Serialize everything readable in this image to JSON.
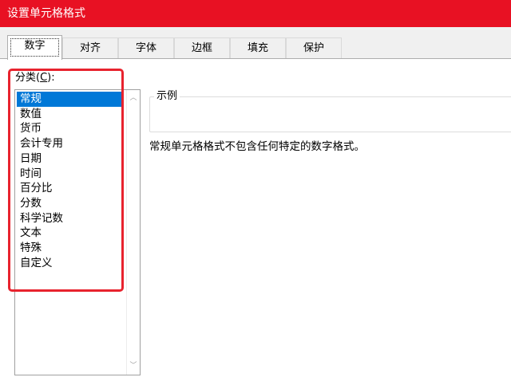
{
  "window": {
    "title": "设置单元格格式"
  },
  "tabs": [
    {
      "label": "数字",
      "active": true
    },
    {
      "label": "对齐"
    },
    {
      "label": "字体"
    },
    {
      "label": "边框"
    },
    {
      "label": "填充"
    },
    {
      "label": "保护"
    }
  ],
  "category": {
    "label_prefix": "分类(",
    "label_hotkey": "C",
    "label_suffix": "):",
    "items": [
      "常规",
      "数值",
      "货币",
      "会计专用",
      "日期",
      "时间",
      "百分比",
      "分数",
      "科学记数",
      "文本",
      "特殊",
      "自定义"
    ],
    "selected": "常规"
  },
  "sample": {
    "legend": "示例",
    "value": ""
  },
  "description": "常规单元格格式不包含任何特定的数字格式。",
  "colors": {
    "titlebar": "#e81123",
    "selection": "#0078d7",
    "annotation": "#e8232e"
  }
}
